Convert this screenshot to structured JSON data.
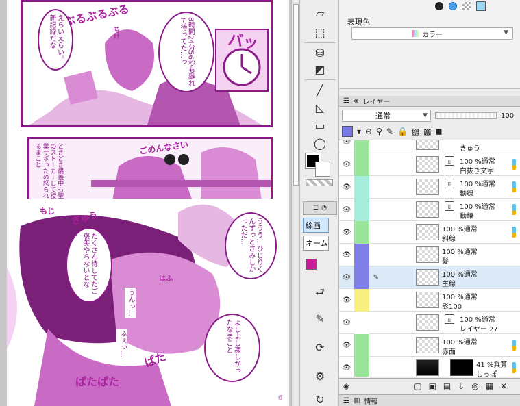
{
  "canvas": {
    "page_number": "6",
    "panel1": {
      "bubble_left": "えらいえらい。新記録だな",
      "bubble_right": "8時間24分56秒も離れて待ってた…っ",
      "sfx_top": "ぶるぶるぶる",
      "sfx_right": "バッ",
      "small_text": "時計"
    },
    "panel2": {
      "narration": "ときどき講義中も聖のストーカーして授業サボったの怒られるまこと",
      "sfx": "ごめんなさい"
    },
    "panel3": {
      "bubble_main": "たくさん待してたご褒美やらないとな",
      "bubble_top_right": "ううう…ひじりくんずっとさみしかっただ…",
      "bubble_bottom_right": "よしよし寂しかったなまこと",
      "text_a": "うんっ…",
      "text_b": "ふぇっ…",
      "sfx_1": "もじ",
      "sfx_2": "ぎゅう",
      "sfx_3": "はふ",
      "sfx_4": "ぱた",
      "sfx_5": "ぱたぱた"
    }
  },
  "tools": {
    "subtool_selected": "線画",
    "subtool_other": "ネーム"
  },
  "color_panel": {
    "label": "表現色",
    "select_value": "カラー"
  },
  "layer_panel": {
    "tab_label": "レイヤー",
    "blend_mode": "通常",
    "opacity_value": "100",
    "layers": [
      {
        "line1": "",
        "line2": "きゅう",
        "band": "#9be59b",
        "selected": false
      },
      {
        "line1": "100 %通常",
        "line2": "白抜き文字",
        "band": "#9be59b",
        "selected": false
      },
      {
        "line1": "100 %通常",
        "line2": "動線",
        "band": "#a7eedc",
        "selected": false
      },
      {
        "line1": "100 %通常",
        "line2": "動線",
        "band": "#a7eedc",
        "selected": false
      },
      {
        "line1": "100 %通常",
        "line2": "斜線",
        "band": "#9be59b",
        "selected": false
      },
      {
        "line1": "100 %通常",
        "line2": "髪",
        "band": "#8080e8",
        "selected": false
      },
      {
        "line1": "100 %通常",
        "line2": "主線",
        "band": "#8080e8",
        "selected": true
      },
      {
        "line1": "100 %通常",
        "line2": "影100",
        "band": "#f7ef80",
        "selected": false
      },
      {
        "line1": "100 %通常",
        "line2": "レイヤー 27",
        "band": "#ffffff",
        "selected": false
      },
      {
        "line1": "100 %通常",
        "line2": "赤面",
        "band": "#9be59b",
        "selected": false
      },
      {
        "line1": "41 %乗算",
        "line2": "しっぽ",
        "band": "#9be59b",
        "selected": false
      }
    ]
  },
  "bottom_tab": {
    "label": "情報"
  },
  "colors": {
    "accent_magenta": "#8b1a88",
    "selected_row": "#dcebf7"
  }
}
